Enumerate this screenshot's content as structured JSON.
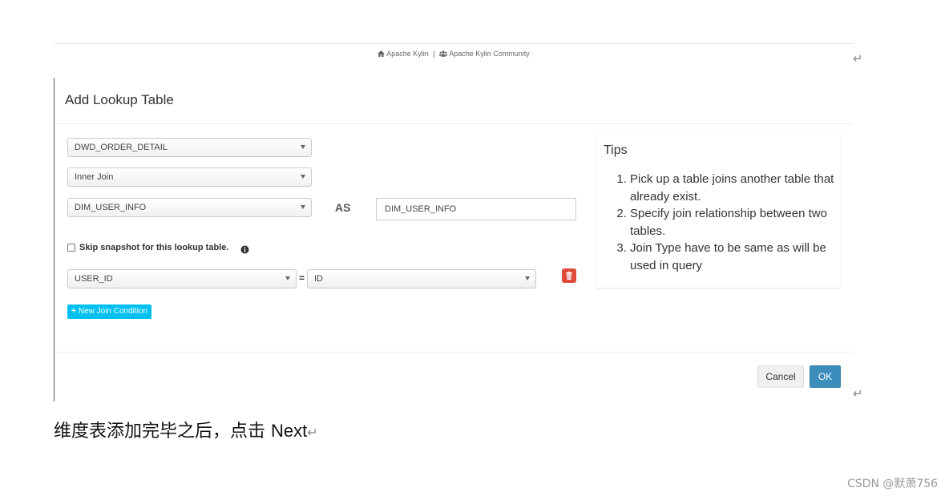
{
  "footer": {
    "link1": "Apache Kylin",
    "separator": "|",
    "link2": "Apache Kylin Community",
    "icons": [
      "home-icon",
      "users-icon"
    ]
  },
  "paragraph_mark": "↵",
  "dialog": {
    "title": "Add Lookup Table",
    "fact_table_select": "DWD_ORDER_DETAIL",
    "join_type_select": "Inner Join",
    "lookup_table_select": "DIM_USER_INFO",
    "as_label": "AS",
    "alias_value": "DIM_USER_INFO",
    "skip_snapshot_label": "Skip snapshot for this lookup table.",
    "join_condition": {
      "fk_select": "USER_ID",
      "equals": "=",
      "pk_select": "ID"
    },
    "new_join_button": "New Join Condition",
    "new_join_plus": "+",
    "cancel_label": "Cancel",
    "ok_label": "OK",
    "colors": {
      "primary": "#3c8dbc",
      "info": "#00c0ef",
      "danger": "#dd4b39"
    }
  },
  "tips": {
    "title": "Tips",
    "items": [
      "Pick up a table joins another table that already exist.",
      "Specify join relationship between two tables.",
      "Join Type have to be same as will be used in query"
    ]
  },
  "caption": {
    "text": "维度表添加完毕之后，点击 ",
    "next": "Next",
    "mark": "↵"
  },
  "watermark": "CSDN @默萧756"
}
